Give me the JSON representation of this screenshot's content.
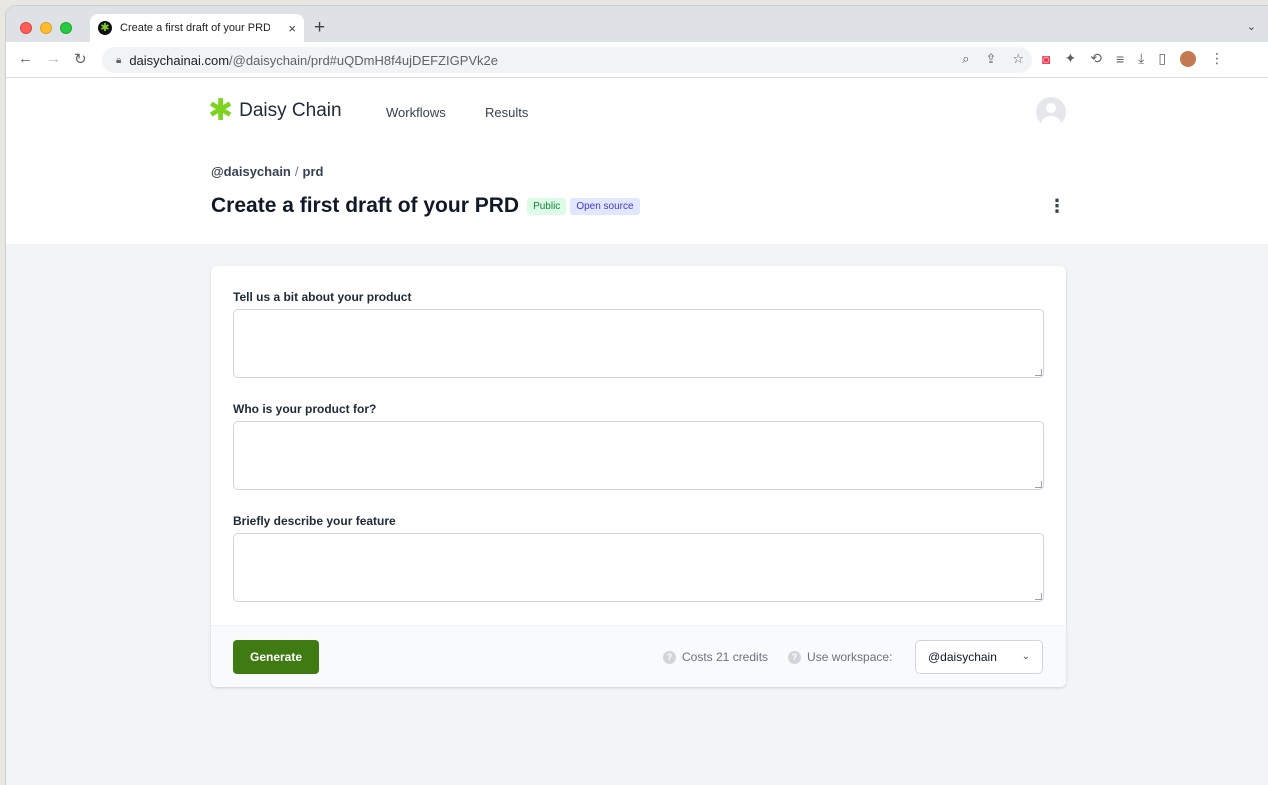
{
  "browser": {
    "tab_title": "Create a first draft of your PRD",
    "tab_close": "×",
    "new_tab": "+",
    "url_host": "daisychainai.com",
    "url_path": "/@daisychain/prd#uQDmH8f4ujDEFZIGPVk2e"
  },
  "header": {
    "logo_mark": "✱",
    "logo_text": "Daisy Chain",
    "nav": [
      "Workflows",
      "Results"
    ]
  },
  "breadcrumb": {
    "owner": "@daisychain",
    "separator": "/",
    "slug": "prd"
  },
  "page": {
    "title": "Create a first draft of your PRD",
    "badge_public": "Public",
    "badge_open_source": "Open source",
    "menu_glyph": "⋮"
  },
  "form": {
    "fields": [
      {
        "label": "Tell us a bit about your product",
        "value": ""
      },
      {
        "label": "Who is your product for?",
        "value": ""
      },
      {
        "label": "Briefly describe your feature",
        "value": ""
      }
    ],
    "generate_label": "Generate",
    "help_glyph": "?",
    "cost_text": "Costs 21 credits",
    "workspace_label": "Use workspace:",
    "workspace_value": "@daisychain"
  },
  "colors": {
    "brand_green": "#7ed321",
    "button_green": "#3f7a12",
    "badge_public_bg": "#dcfce7",
    "badge_open_source_bg": "#e0e7ff"
  }
}
